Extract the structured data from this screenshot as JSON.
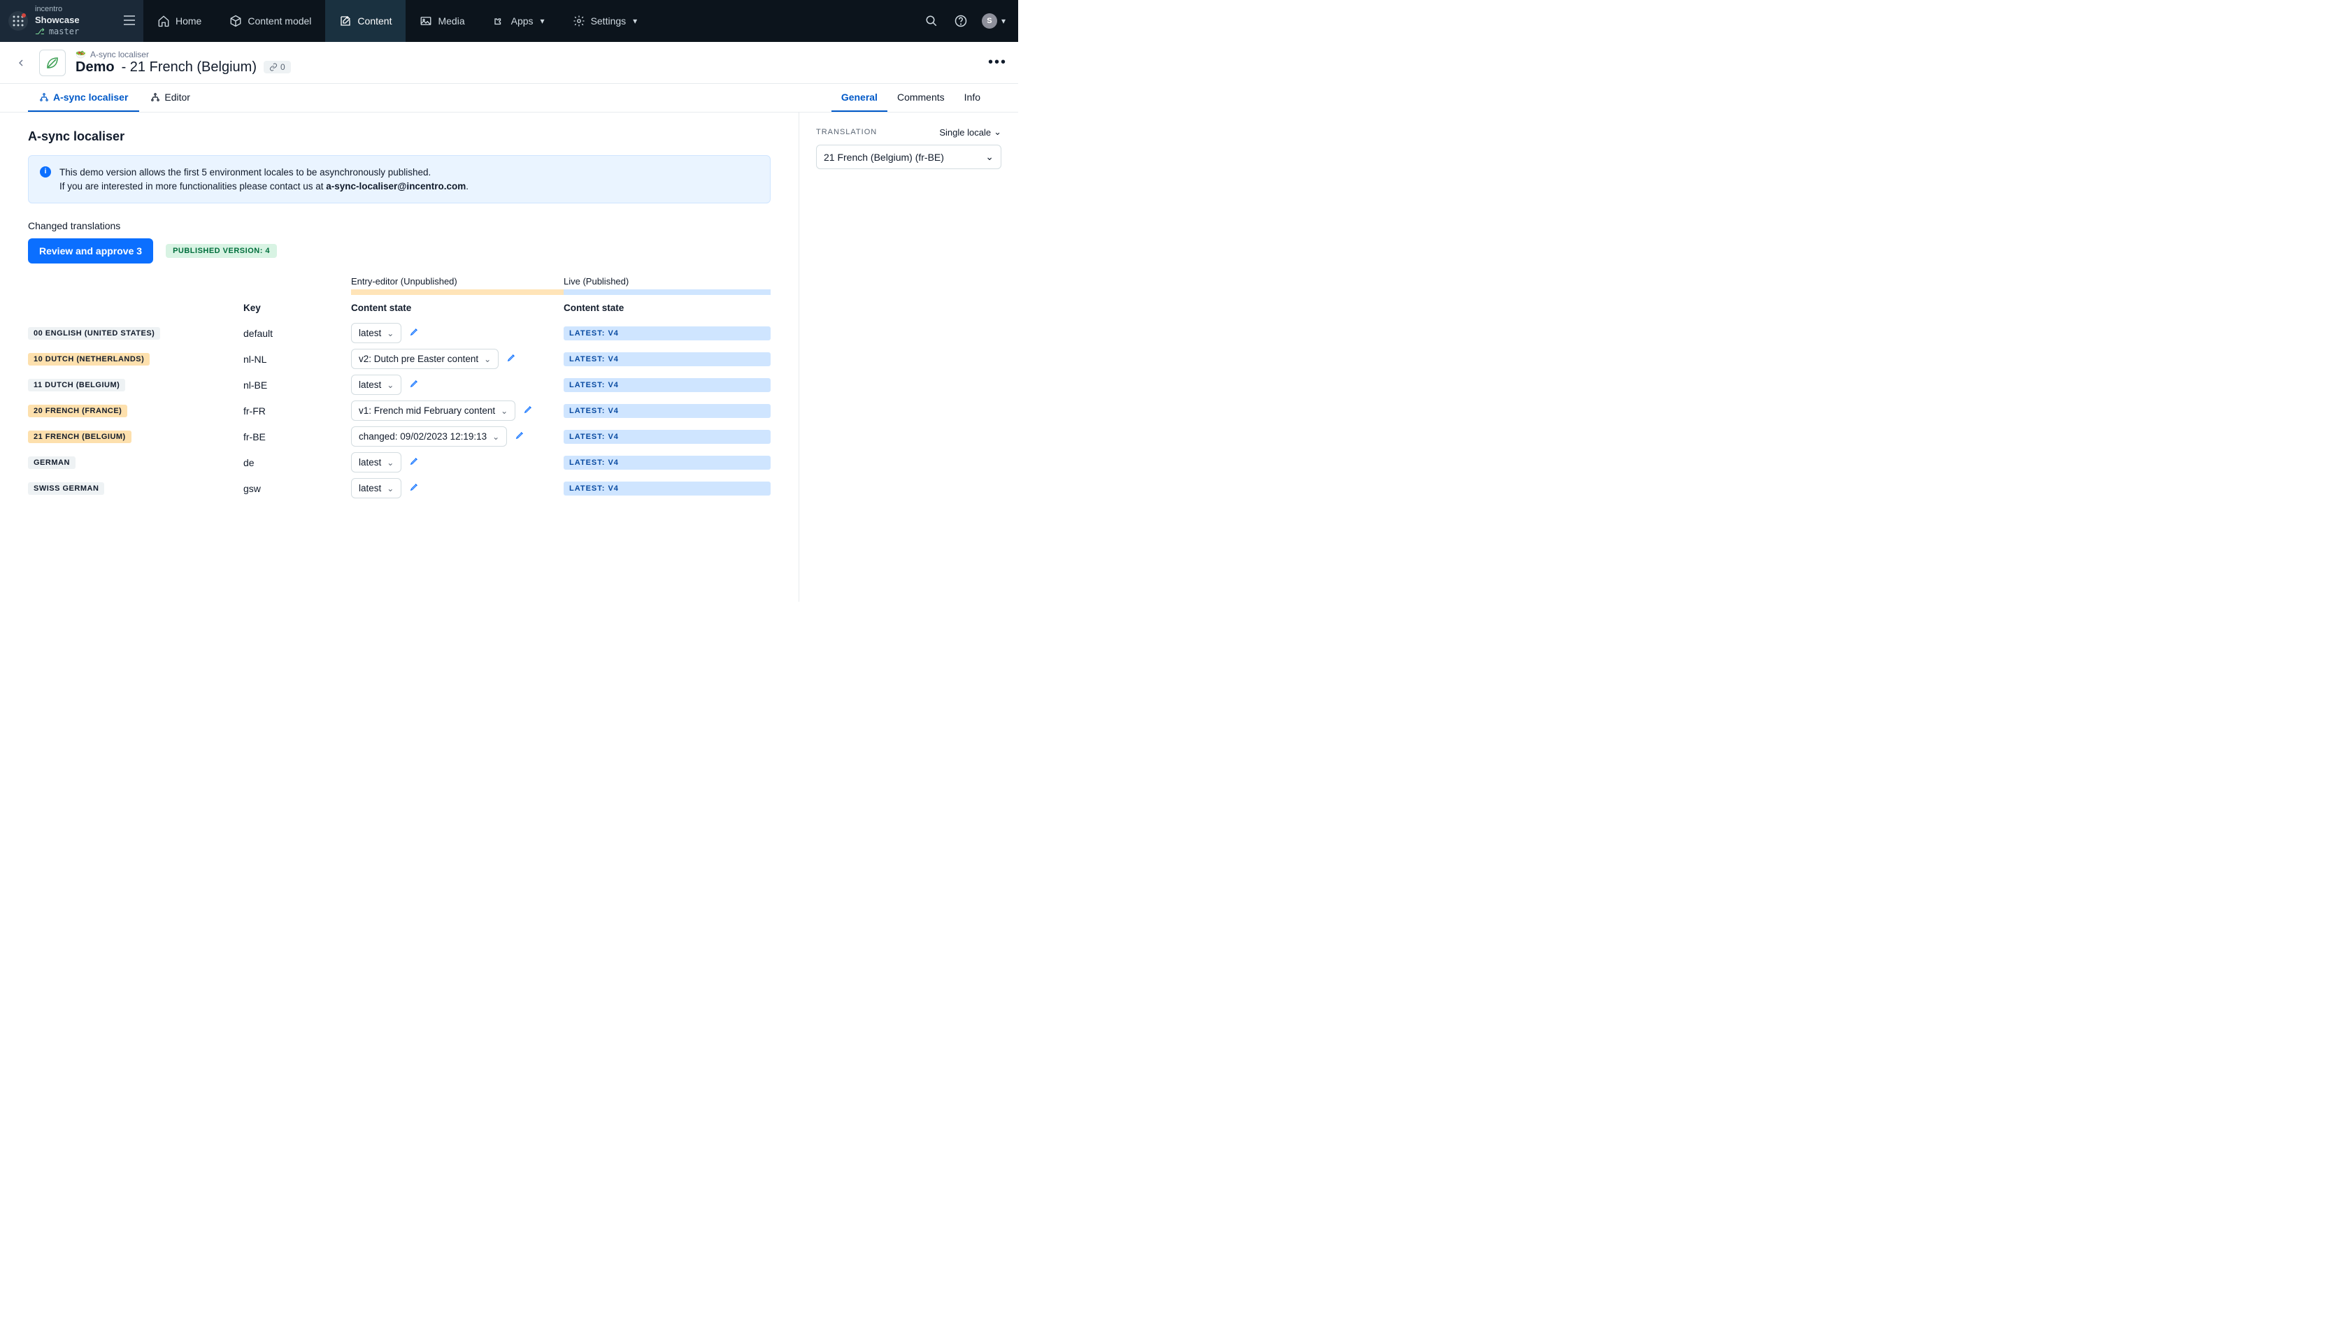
{
  "topbar": {
    "org": "incentro",
    "space": "Showcase",
    "env": "master",
    "nav": [
      {
        "label": "Home"
      },
      {
        "label": "Content model"
      },
      {
        "label": "Content"
      },
      {
        "label": "Media"
      },
      {
        "label": "Apps"
      },
      {
        "label": "Settings"
      }
    ],
    "avatar_initial": "S"
  },
  "entry": {
    "breadcrumb_icon": "🥗",
    "breadcrumb": "A-sync localiser",
    "title_main": "Demo",
    "title_sub": " - 21 French (Belgium)",
    "link_count": "0"
  },
  "tabs_left": [
    {
      "label": "A-sync localiser",
      "active": true
    },
    {
      "label": "Editor",
      "active": false
    }
  ],
  "tabs_right": [
    {
      "label": "General",
      "active": true
    },
    {
      "label": "Comments",
      "active": false
    },
    {
      "label": "Info",
      "active": false
    }
  ],
  "section_title": "A-sync localiser",
  "info": {
    "line1": "This demo version allows the first 5 environment locales to be asynchronously published.",
    "line2_a": "If you are interested in more functionalities please contact us at ",
    "email": "a-sync-localiser@incentro.com",
    "line2_b": "."
  },
  "changed_label": "Changed translations",
  "review_btn": "Review and approve 3",
  "published_badge": "PUBLISHED VERSION: 4",
  "head": {
    "entry_editor": "Entry-editor (Unpublished)",
    "live": "Live (Published)",
    "key": "Key",
    "cs1": "Content state",
    "cs2": "Content state"
  },
  "rows": [
    {
      "locale": "00 ENGLISH (UNITED STATES)",
      "amber": false,
      "key": "default",
      "state": "latest",
      "live": "LATEST: V4"
    },
    {
      "locale": "10 DUTCH (NETHERLANDS)",
      "amber": true,
      "key": "nl-NL",
      "state": "v2: Dutch pre Easter content",
      "live": "LATEST: V4"
    },
    {
      "locale": "11 DUTCH (BELGIUM)",
      "amber": false,
      "key": "nl-BE",
      "state": "latest",
      "live": "LATEST: V4"
    },
    {
      "locale": "20 FRENCH (FRANCE)",
      "amber": true,
      "key": "fr-FR",
      "state": "v1: French mid February content",
      "live": "LATEST: V4"
    },
    {
      "locale": "21 FRENCH (BELGIUM)",
      "amber": true,
      "key": "fr-BE",
      "state": "changed: 09/02/2023 12:19:13",
      "live": "LATEST: V4"
    },
    {
      "locale": "GERMAN",
      "amber": false,
      "key": "de",
      "state": "latest",
      "live": "LATEST: V4"
    },
    {
      "locale": "SWISS GERMAN",
      "amber": false,
      "key": "gsw",
      "state": "latest",
      "live": "LATEST: V4"
    }
  ],
  "sidebar": {
    "section": "TRANSLATION",
    "mode": "Single locale",
    "selected": "21 French (Belgium) (fr-BE)"
  }
}
